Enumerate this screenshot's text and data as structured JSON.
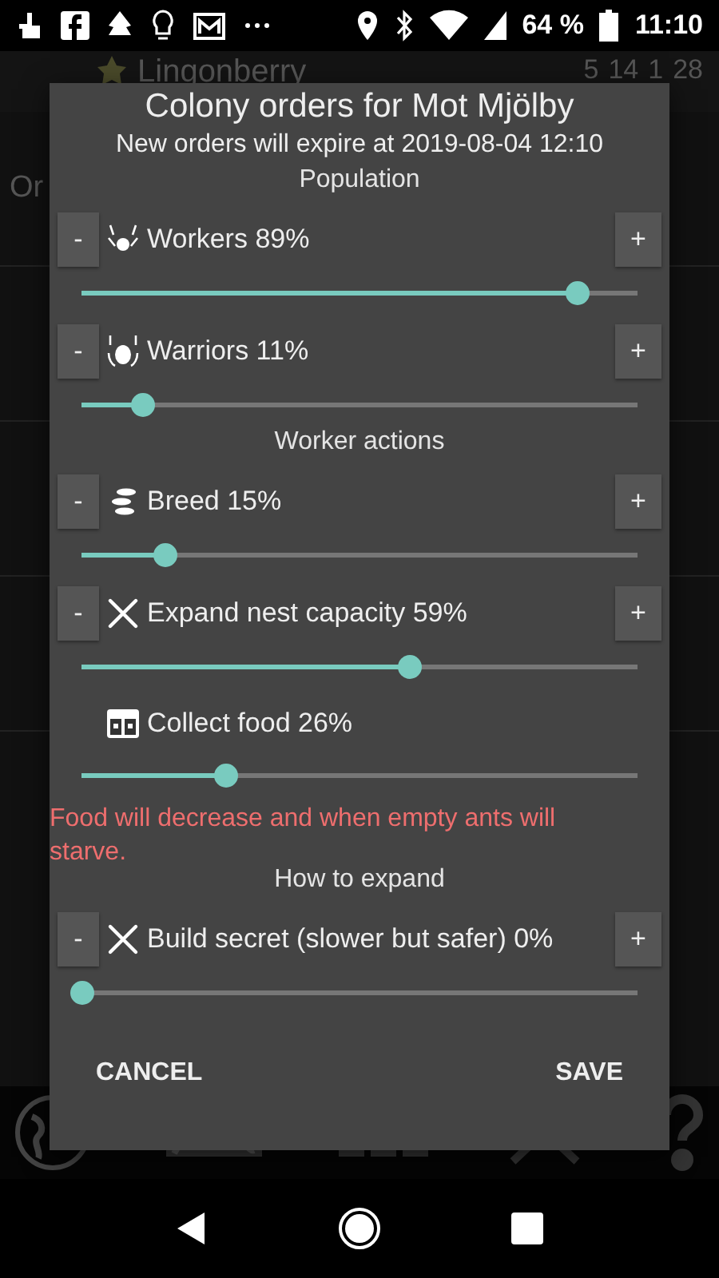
{
  "status_bar": {
    "battery": "64 %",
    "time": "11:10"
  },
  "background": {
    "title": "Lingonberry",
    "stats": [
      "5",
      "14",
      "1",
      "28"
    ],
    "section": "Or"
  },
  "dialog": {
    "title": "Colony orders for Mot Mjölby",
    "subtitle": "New orders will expire at 2019-08-04 12:10",
    "sections": [
      {
        "heading": "Population",
        "items": [
          {
            "kind": "stepper",
            "label": "Workers 89%",
            "level": 0.89,
            "decrease": "-",
            "increase": "+"
          },
          {
            "kind": "stepper",
            "label": "Warriors 11%",
            "level": 0.11,
            "decrease": "-",
            "increase": "+"
          }
        ]
      },
      {
        "heading": "Worker actions",
        "items": [
          {
            "kind": "stepper",
            "label": "Breed 15%",
            "level": 0.15,
            "decrease": "-",
            "increase": "+"
          },
          {
            "kind": "stepper",
            "label": "Expand nest capacity 59%",
            "level": 0.59,
            "decrease": "-",
            "increase": "+"
          },
          {
            "kind": "plain",
            "label": "Collect food 26%",
            "level": 0.26
          }
        ],
        "warning": "Food will decrease and when empty ants will starve."
      },
      {
        "heading": "How to expand",
        "items": [
          {
            "kind": "stepper",
            "label": "Build secret (slower but safer) 0%",
            "level": 0,
            "decrease": "-",
            "increase": "+"
          }
        ]
      }
    ],
    "buttons": [
      "CANCEL",
      "SAVE"
    ]
  }
}
